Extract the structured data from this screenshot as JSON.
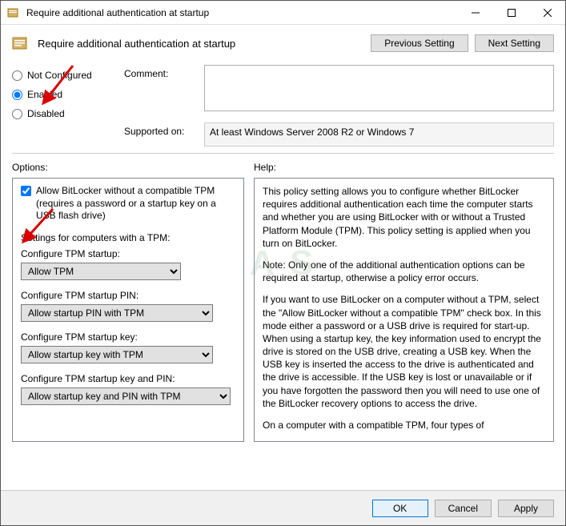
{
  "window": {
    "title": "Require additional authentication at startup"
  },
  "header": {
    "policyTitle": "Require additional authentication at startup",
    "previous": "Previous Setting",
    "next": "Next Setting"
  },
  "radios": {
    "notConfigured": "Not Configured",
    "enabled": "Enabled",
    "disabled": "Disabled"
  },
  "fields": {
    "commentLabel": "Comment:",
    "commentValue": "",
    "supportedLabel": "Supported on:",
    "supportedValue": "At least Windows Server 2008 R2 or Windows 7"
  },
  "columns": {
    "options": "Options:",
    "help": "Help:"
  },
  "options": {
    "allowNoTpmLabel": "Allow BitLocker without a compatible TPM (requires a password or a startup key on a USB flash drive)",
    "tpmSettingsHeader": "Settings for computers with a TPM:",
    "tpmStartupLabel": "Configure TPM startup:",
    "tpmStartupValue": "Allow TPM",
    "tpmPinLabel": "Configure TPM startup PIN:",
    "tpmPinValue": "Allow startup PIN with TPM",
    "tpmKeyLabel": "Configure TPM startup key:",
    "tpmKeyValue": "Allow startup key with TPM",
    "tpmKeyPinLabel": "Configure TPM startup key and PIN:",
    "tpmKeyPinValue": "Allow startup key and PIN with TPM"
  },
  "help": {
    "p1": "This policy setting allows you to configure whether BitLocker requires additional authentication each time the computer starts and whether you are using BitLocker with or without a Trusted Platform Module (TPM). This policy setting is applied when you turn on BitLocker.",
    "p2": "Note: Only one of the additional authentication options can be required at startup, otherwise a policy error occurs.",
    "p3": "If you want to use BitLocker on a computer without a TPM, select the \"Allow BitLocker without a compatible TPM\" check box. In this mode either a password or a USB drive is required for start-up. When using a startup key, the key information used to encrypt the drive is stored on the USB drive, creating a USB key. When the USB key is inserted the access to the drive is authenticated and the drive is accessible. If the USB key is lost or unavailable or if you have forgotten the password then you will need to use one of the BitLocker recovery options to access the drive.",
    "p4": "On a computer with a compatible TPM, four types of"
  },
  "footer": {
    "ok": "OK",
    "cancel": "Cancel",
    "apply": "Apply"
  },
  "watermark": "A   S"
}
